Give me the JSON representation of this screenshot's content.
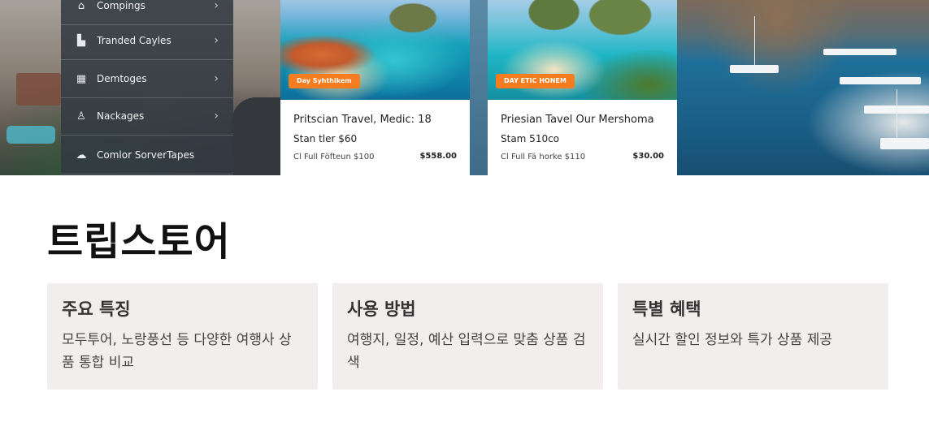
{
  "hero": {
    "menu": {
      "items": [
        {
          "label": "Compings",
          "icon": "house-icon"
        },
        {
          "label": "Tranded Cayles",
          "icon": "buildings-icon"
        },
        {
          "label": "Demtoges",
          "icon": "box-icon"
        },
        {
          "label": "Nackages",
          "icon": "person-icon"
        },
        {
          "label": "Comlor SorverTapes",
          "icon": "chat-icon"
        }
      ]
    },
    "cards": [
      {
        "badge": "Day Syhthikem",
        "title": "Pritscian Travel, Medic: 18",
        "subtitle": "Stan tler $60",
        "meta": "Cl Full Föfteun $100",
        "price": "$558.00"
      },
      {
        "badge": "DAY ETIC HONEM",
        "title": "Priesian Tavel Our Mershoma",
        "subtitle": "Stam 510co",
        "meta": "Cl Full Fä horke $110",
        "price": "$30.00"
      }
    ]
  },
  "brand": {
    "title": "트립스토어"
  },
  "features": [
    {
      "heading": "주요 특징",
      "text": "모두투어, 노랑풍선 등 다양한 여행사 상품 통합 비교"
    },
    {
      "heading": "사용 방법",
      "text": "여행지, 일정, 예산 입력으로 맞춤 상품 검색"
    },
    {
      "heading": "특별 혜택",
      "text": "실시간 할인 정보와 특가 상품 제공"
    }
  ],
  "colors": {
    "badge": "#f57c1f",
    "feature_bg": "#f1eeed",
    "menu_bg": "#323a42"
  }
}
